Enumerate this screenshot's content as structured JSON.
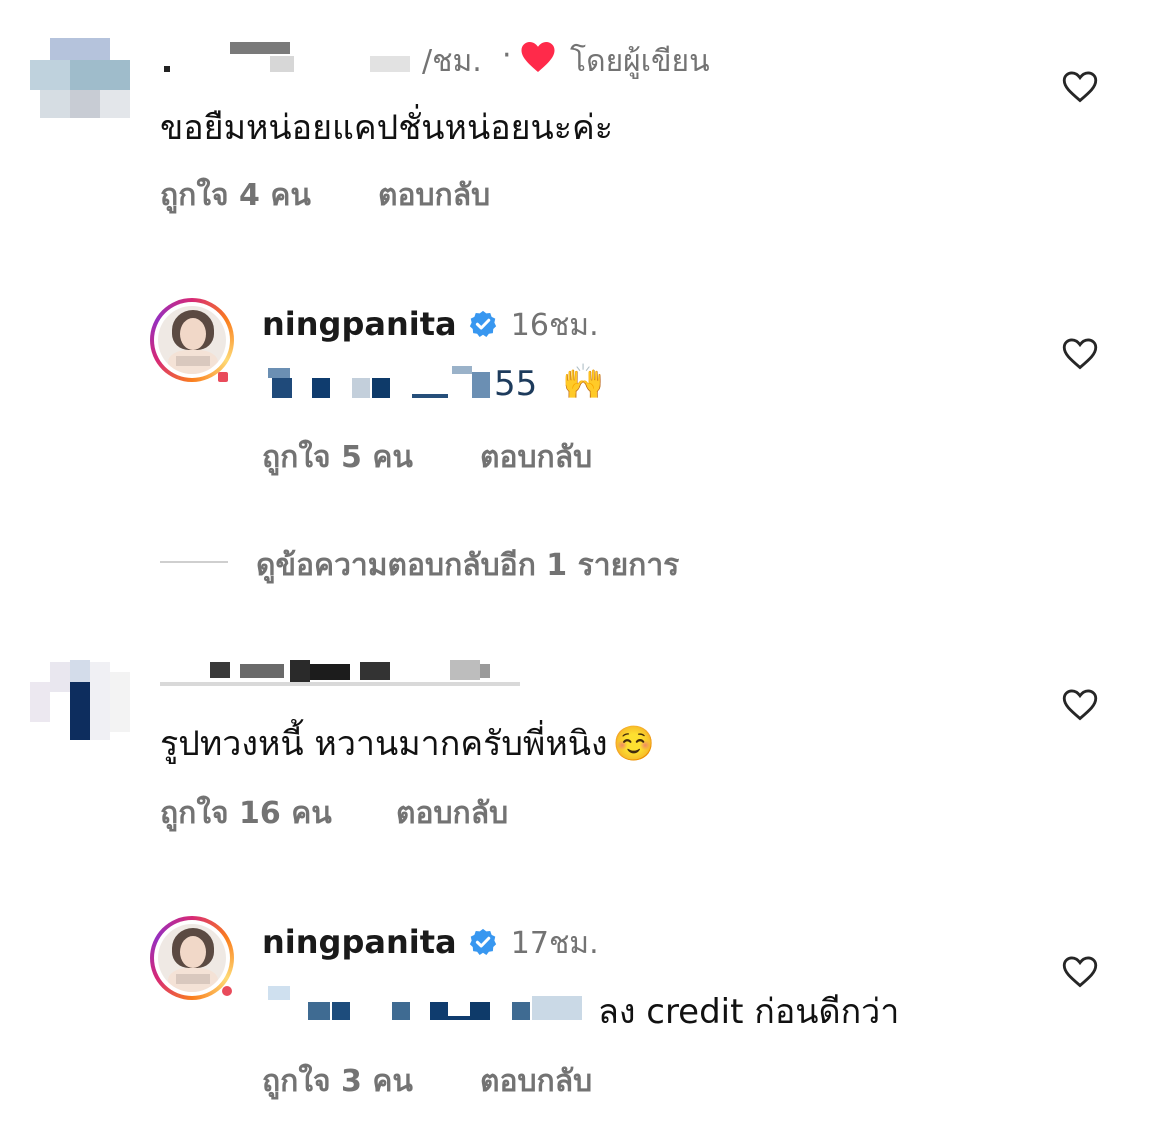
{
  "comments": [
    {
      "username": "",
      "time": "/ชม.",
      "separator": "·",
      "liked_by_author": "โดยผู้เขียน",
      "text": "ขอยืมหน่อยแคปชั่นหน่อยนะค่ะ",
      "likes": "ถูกใจ 4 คน",
      "reply": "ตอบกลับ"
    },
    {
      "username": "ningpanita",
      "verified": true,
      "time": "16ชม.",
      "text_visible": "55",
      "emoji": "🙌",
      "likes": "ถูกใจ 5 คน",
      "reply": "ตอบกลับ"
    },
    {
      "view_more": "ดูข้อความตอบกลับอีก 1 รายการ"
    },
    {
      "username": "",
      "text": "รูปทวงหนี้ หวานมากครับพี่หนิง",
      "emoji": "☺️",
      "likes": "ถูกใจ 16 คน",
      "reply": "ตอบกลับ"
    },
    {
      "username": "ningpanita",
      "verified": true,
      "time": "17ชม.",
      "text_visible": "ลง credit ก่อนดีกว่า",
      "likes": "ถูกใจ 3 คน",
      "reply": "ตอบกลับ"
    }
  ],
  "icons": {
    "heart": "heart-outline-icon",
    "author_heart": "heart-filled-icon",
    "verified": "verified-badge-icon"
  },
  "colors": {
    "heart_red": "#ff2a4a",
    "verified_blue": "#3897f0",
    "secondary_text": "#737373"
  }
}
